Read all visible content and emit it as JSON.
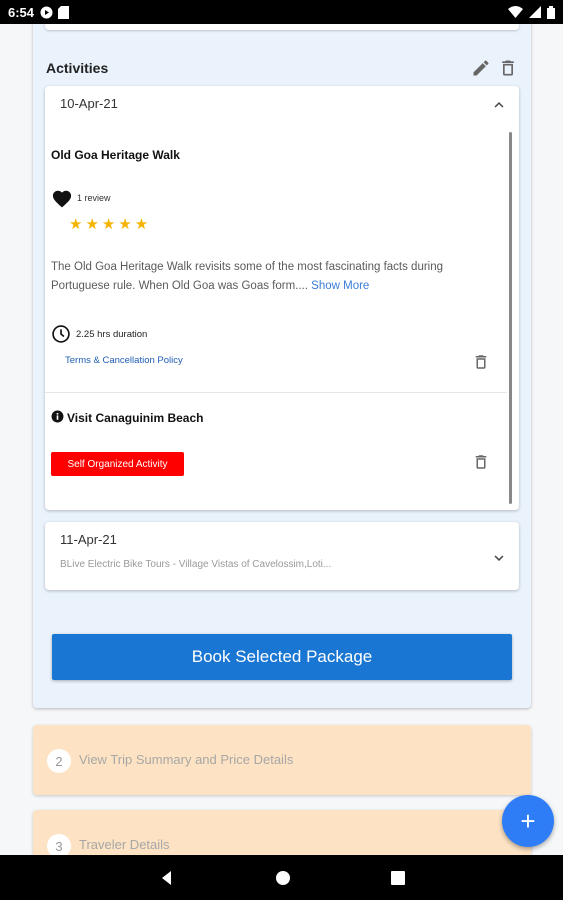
{
  "status_bar": {
    "time": "6:54"
  },
  "activities": {
    "title": "Activities",
    "day1": {
      "date": "10-Apr-21",
      "item1": {
        "name": "Old Goa Heritage Walk",
        "reviews": "1 review",
        "stars": "★★★★★",
        "rating": 5,
        "description": "The Old Goa Heritage Walk revisits some of the most fascinating facts during Portuguese rule. When Old Goa was Goas form....",
        "show_more": "Show More",
        "duration": "2.25 hrs duration",
        "policy": "Terms & Cancellation Policy"
      },
      "item2": {
        "name": "Visit Canaguinim Beach",
        "badge": "Self Organized Activity"
      }
    },
    "day2": {
      "date": "11-Apr-21",
      "subtitle": "BLive Electric Bike Tours - Village Vistas of Cavelossim,Loti..."
    }
  },
  "book_button": "Book Selected Package",
  "steps": [
    {
      "number": "2",
      "label": "View Trip Summary and Price Details"
    },
    {
      "number": "3",
      "label": "Traveler Details"
    }
  ],
  "fab": "+",
  "colors": {
    "primary": "#1976d2",
    "badge": "#ff0000",
    "star": "#f5b400",
    "step_bg": "#fde3c3",
    "link": "#3b7dd8"
  }
}
